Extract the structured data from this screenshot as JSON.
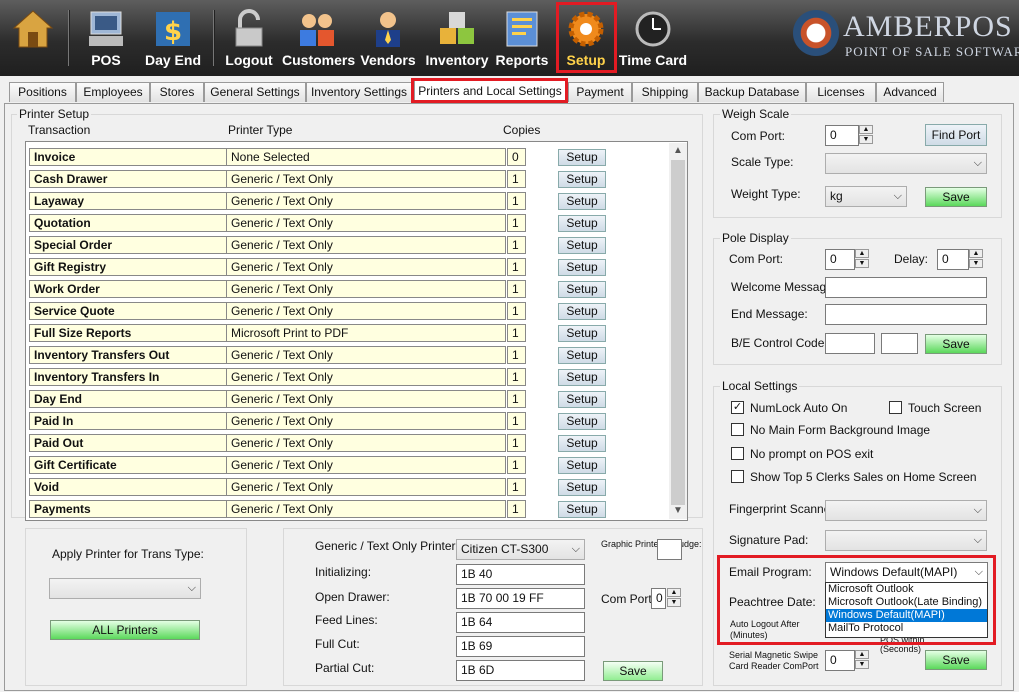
{
  "toolbar": {
    "buttons": [
      {
        "label": "",
        "icon": "home-icon"
      },
      {
        "label": "POS",
        "icon": "pos-terminal-icon"
      },
      {
        "label": "Day End",
        "icon": "day-end-icon"
      },
      {
        "label": "Logout",
        "icon": "logout-lock-icon"
      },
      {
        "label": "Customers",
        "icon": "customers-icon"
      },
      {
        "label": "Vendors",
        "icon": "vendors-icon"
      },
      {
        "label": "Inventory",
        "icon": "inventory-icon"
      },
      {
        "label": "Reports",
        "icon": "reports-icon"
      },
      {
        "label": "Setup",
        "icon": "gear-icon"
      },
      {
        "label": "Time Card",
        "icon": "time-card-icon"
      }
    ],
    "logo_title": "AMBERPOS",
    "logo_subtitle": "POINT OF SALE SOFTWARE"
  },
  "tabs": [
    "Positions",
    "Employees",
    "Stores",
    "General Settings",
    "Inventory Settings",
    "Printers and Local Settings",
    "Payment",
    "Shipping",
    "Backup Database",
    "Licenses",
    "Advanced"
  ],
  "printer_setup": {
    "title": "Printer Setup",
    "col_transaction": "Transaction",
    "col_printer_type": "Printer Type",
    "col_copies": "Copies",
    "setup_label": "Setup",
    "rows": [
      {
        "transaction": "Invoice",
        "printer": "None Selected",
        "copies": "0"
      },
      {
        "transaction": "Cash Drawer",
        "printer": "Generic / Text Only",
        "copies": "1"
      },
      {
        "transaction": "Layaway",
        "printer": "Generic / Text Only",
        "copies": "1"
      },
      {
        "transaction": "Quotation",
        "printer": "Generic / Text Only",
        "copies": "1"
      },
      {
        "transaction": "Special Order",
        "printer": "Generic / Text Only",
        "copies": "1"
      },
      {
        "transaction": "Gift Registry",
        "printer": "Generic / Text Only",
        "copies": "1"
      },
      {
        "transaction": "Work Order",
        "printer": "Generic / Text Only",
        "copies": "1"
      },
      {
        "transaction": "Service Quote",
        "printer": "Generic / Text Only",
        "copies": "1"
      },
      {
        "transaction": "Full Size Reports",
        "printer": "Microsoft Print to PDF",
        "copies": "1"
      },
      {
        "transaction": "Inventory Transfers Out",
        "printer": "Generic / Text Only",
        "copies": "1"
      },
      {
        "transaction": "Inventory Transfers In",
        "printer": "Generic / Text Only",
        "copies": "1"
      },
      {
        "transaction": "Day End",
        "printer": "Generic / Text Only",
        "copies": "1"
      },
      {
        "transaction": "Paid In",
        "printer": "Generic / Text Only",
        "copies": "1"
      },
      {
        "transaction": "Paid Out",
        "printer": "Generic / Text Only",
        "copies": "1"
      },
      {
        "transaction": "Gift Certificate",
        "printer": "Generic / Text Only",
        "copies": "1"
      },
      {
        "transaction": "Void",
        "printer": "Generic / Text Only",
        "copies": "1"
      },
      {
        "transaction": "Payments",
        "printer": "Generic / Text Only",
        "copies": "1"
      }
    ]
  },
  "apply_printer": {
    "label": "Apply Printer for Trans Type:",
    "select_value": "",
    "all_printers_label": "ALL Printers"
  },
  "generic_printer": {
    "printer_label": "Generic / Text Only Printer:",
    "printer_value": "Citizen CT-S300",
    "nudge_label": "Graphic Printer X Nudge:",
    "nudge_value": "",
    "initializing_label": "Initializing:",
    "initializing_value": "1B 40",
    "open_drawer_label": "Open Drawer:",
    "open_drawer_value": "1B 70 00 19 FF",
    "com_port_label": "Com Port:",
    "com_port_value": "0",
    "feed_lines_label": "Feed Lines:",
    "feed_lines_value": "1B 64",
    "full_cut_label": "Full Cut:",
    "full_cut_value": "1B 69",
    "partial_cut_label": "Partial Cut:",
    "partial_cut_value": "1B 6D",
    "save_label": "Save"
  },
  "weigh_scale": {
    "title": "Weigh Scale",
    "com_port_label": "Com Port:",
    "com_port_value": "0",
    "find_port_label": "Find Port",
    "scale_type_label": "Scale Type:",
    "scale_type_value": "",
    "weight_type_label": "Weight Type:",
    "weight_type_value": "kg",
    "save_label": "Save"
  },
  "pole_display": {
    "title": "Pole Display",
    "com_port_label": "Com Port:",
    "com_port_value": "0",
    "delay_label": "Delay:",
    "delay_value": "0",
    "welcome_label": "Welcome Message:",
    "welcome_value": "",
    "end_label": "End Message:",
    "end_value": "",
    "control_code_label": "B/E Control Code:",
    "save_label": "Save"
  },
  "local_settings": {
    "title": "Local Settings",
    "numlock_label": "NumLock Auto On",
    "numlock_checked": "✓",
    "touch_label": "Touch Screen",
    "no_bg_label": "No Main Form  Background Image",
    "no_prompt_label": "No prompt on POS exit",
    "show_top_label": "Show Top 5 Clerks Sales on Home Screen",
    "fingerprint_label": "Fingerprint Scanner:",
    "signature_label": "Signature Pad:",
    "email_label": "Email Program:",
    "email_value": "Windows Default(MAPI)",
    "email_options": [
      "Microsoft Outlook",
      "Microsoft Outlook(Late Binding)",
      "Windows Default(MAPI)",
      "MailTo Protocol"
    ],
    "peachtree_label": "Peachtree Date:",
    "auto_logout_label": "Auto Logout After (Minutes)",
    "pos_within_label": "POS within",
    "seconds_label": "(Seconds)",
    "serial_label": "Serial Magnetic Swipe Card Reader ComPort",
    "serial_value": "0",
    "save_label": "Save"
  },
  "colors": {
    "highlight_red": "#e21b23",
    "grid_cell": "#ffffe0",
    "save_green": "#5bd85b"
  }
}
